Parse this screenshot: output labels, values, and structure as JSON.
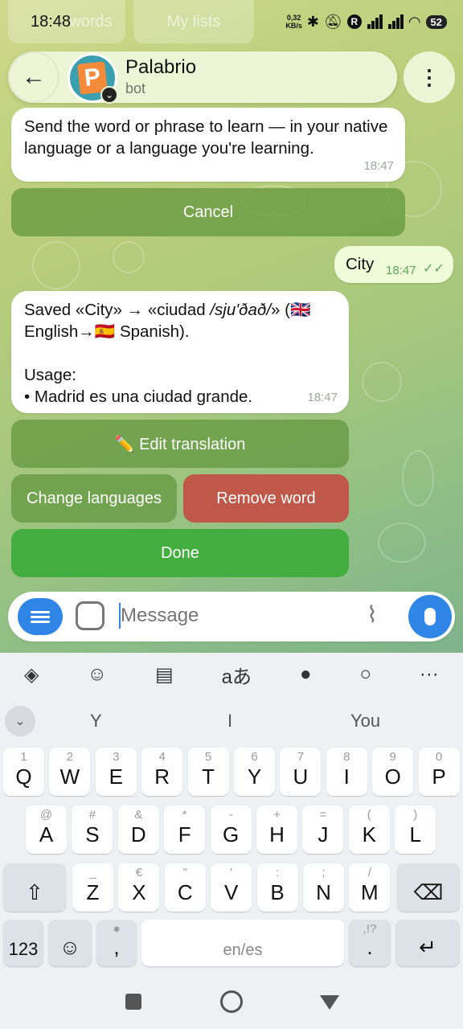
{
  "status": {
    "time": "18:48",
    "speed_value": "0,32",
    "speed_unit": "KB/s",
    "battery": "52"
  },
  "ghost_tabs": {
    "words": "words",
    "lists": "My lists"
  },
  "header": {
    "bot_name": "Palabrio",
    "bot_sub": "bot",
    "avatar_letter": "P"
  },
  "messages": [
    {
      "text": "Send the word or phrase to learn — in your native language or a language you're learning.",
      "time": "18:47"
    },
    {
      "text": "City",
      "time": "18:47"
    },
    {
      "line1": "Saved «City» → «ciudad ",
      "phon": "/sju'ðað/",
      "line1b": "» (🇬🇧",
      "line2": "English→🇪🇸 Spanish).",
      "usage_label": "Usage:",
      "usage": "• Madrid es una ciudad grande.",
      "time": "18:47"
    }
  ],
  "buttons": {
    "cancel": "Cancel",
    "edit": "✏️ Edit translation",
    "change": "Change languages",
    "remove": "Remove word",
    "done": "Done"
  },
  "colors": {
    "accent": "#2f86e6",
    "remove": "#c0584a",
    "done": "#43ad3f"
  },
  "input": {
    "placeholder": "Message"
  },
  "keyboard": {
    "suggestions": [
      "Y",
      "I",
      "You"
    ],
    "row1": [
      [
        "1",
        "Q"
      ],
      [
        "2",
        "W"
      ],
      [
        "3",
        "E"
      ],
      [
        "4",
        "R"
      ],
      [
        "5",
        "T"
      ],
      [
        "6",
        "Y"
      ],
      [
        "7",
        "U"
      ],
      [
        "8",
        "I"
      ],
      [
        "9",
        "O"
      ],
      [
        "0",
        "P"
      ]
    ],
    "row2": [
      [
        "@",
        "A"
      ],
      [
        "#",
        "S"
      ],
      [
        "&",
        "D"
      ],
      [
        "*",
        "F"
      ],
      [
        "-",
        "G"
      ],
      [
        "+",
        "H"
      ],
      [
        "=",
        "J"
      ],
      [
        "(",
        "K"
      ],
      [
        ")",
        "L"
      ]
    ],
    "row3": [
      [
        "_",
        "Z"
      ],
      [
        "€",
        "X"
      ],
      [
        "\"",
        "C"
      ],
      [
        "'",
        "V"
      ],
      [
        ":",
        "B"
      ],
      [
        ";",
        "N"
      ],
      [
        "/",
        "M"
      ]
    ],
    "num": "123",
    "space": "en/es",
    "comma": ",",
    "period": ".",
    "period_alt": ",!?"
  }
}
